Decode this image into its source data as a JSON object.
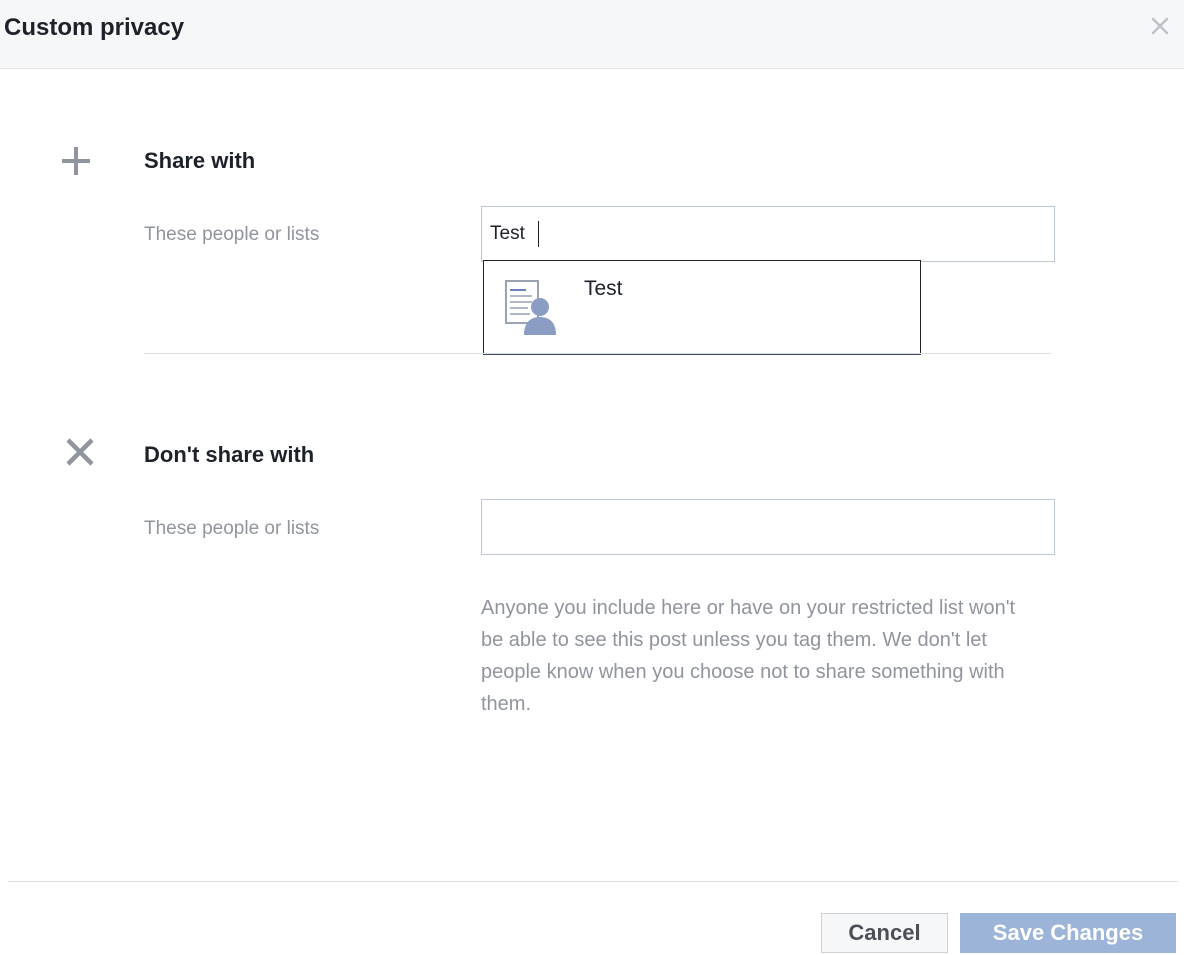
{
  "dialog": {
    "title": "Custom privacy"
  },
  "share_with": {
    "title": "Share with",
    "field_label": "These people or lists",
    "input_value": "Test",
    "typeahead": [
      {
        "label": "Test",
        "icon": "friend-list-icon"
      }
    ]
  },
  "dont_share_with": {
    "title": "Don't share with",
    "field_label": "These people or lists",
    "input_value": "",
    "helper_text": "Anyone you include here or have on your restricted list won't be able to see this post unless you tag them. We don't let people know when you choose not to share something with them."
  },
  "footer": {
    "cancel_label": "Cancel",
    "save_label": "Save Changes"
  },
  "icons": {
    "close": "close-icon",
    "share": "plus-icon",
    "dont_share": "x-icon"
  },
  "colors": {
    "header_bg": "#f6f7f9",
    "title_text": "#1d2129",
    "muted_text": "#90949c",
    "input_border": "#bdc7d8",
    "save_button_disabled": "#9cb4d8",
    "icon_gray": "#90949c"
  }
}
